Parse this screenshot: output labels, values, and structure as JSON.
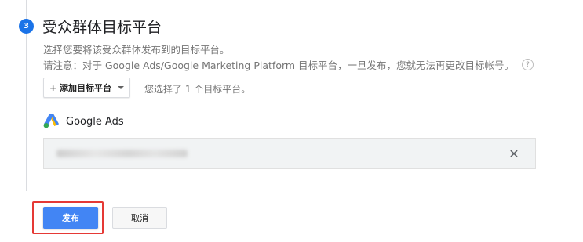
{
  "step": {
    "number": "3",
    "title": "受众群体目标平台"
  },
  "description": {
    "line1": "选择您要将该受众群体发布到的目标平台。",
    "line2": "请注意：对于 Google Ads/Google Marketing Platform 目标平台，一旦发布，您就无法再更改目标帐号。",
    "help_icon": "question-mark-circle"
  },
  "add_target": {
    "label": "+ 添加目标平台"
  },
  "selected_count": "您选择了 1 个目标平台。",
  "platform": {
    "name": "Google Ads",
    "logo": "google-ads-logo"
  },
  "colors": {
    "primary": "#4285f4",
    "step": "#1a73e8",
    "highlight": "#e53935"
  },
  "actions": {
    "publish": "发布",
    "cancel": "取消"
  }
}
